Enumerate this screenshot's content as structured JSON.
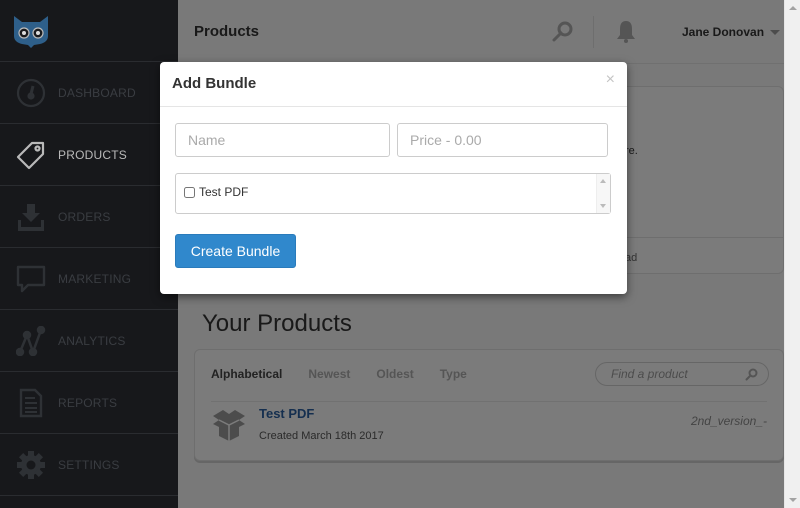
{
  "app": {
    "brand_color": "#2e5f8a",
    "sidebar_bg": "#17181b",
    "accent_color": "#3088cc"
  },
  "sidebar": {
    "logo": "owl-logo",
    "items": [
      {
        "label": "DASHBOARD",
        "icon": "speedometer-icon",
        "active": false
      },
      {
        "label": "PRODUCTS",
        "icon": "tag-icon",
        "active": true
      },
      {
        "label": "ORDERS",
        "icon": "download-tray-icon",
        "active": false
      },
      {
        "label": "MARKETING",
        "icon": "speech-bubble-icon",
        "active": false
      },
      {
        "label": "ANALYTICS",
        "icon": "line-graph-icon",
        "active": false
      },
      {
        "label": "REPORTS",
        "icon": "document-icon",
        "active": false
      },
      {
        "label": "SETTINGS",
        "icon": "gear-icon",
        "active": false
      }
    ]
  },
  "header": {
    "title": "Products",
    "user_name": "Jane Donovan"
  },
  "background_panel": {
    "text_fragment_1": "re.",
    "text_fragment_2": "ad"
  },
  "products_section": {
    "heading": "Your Products",
    "filters": [
      {
        "label": "Alphabetical",
        "active": true
      },
      {
        "label": "Newest",
        "active": false
      },
      {
        "label": "Oldest",
        "active": false
      },
      {
        "label": "Type",
        "active": false
      }
    ],
    "search_placeholder": "Find a product",
    "items": [
      {
        "name": "Test PDF",
        "created": "Created March 18th 2017",
        "version": "2nd_version_-"
      }
    ]
  },
  "modal": {
    "title": "Add Bundle",
    "close_label": "×",
    "name_placeholder": "Name",
    "name_value": "",
    "price_placeholder": "Price - 0.00",
    "price_value": "",
    "product_options": [
      {
        "label": "Test PDF",
        "checked": false
      }
    ],
    "submit_label": "Create Bundle"
  }
}
